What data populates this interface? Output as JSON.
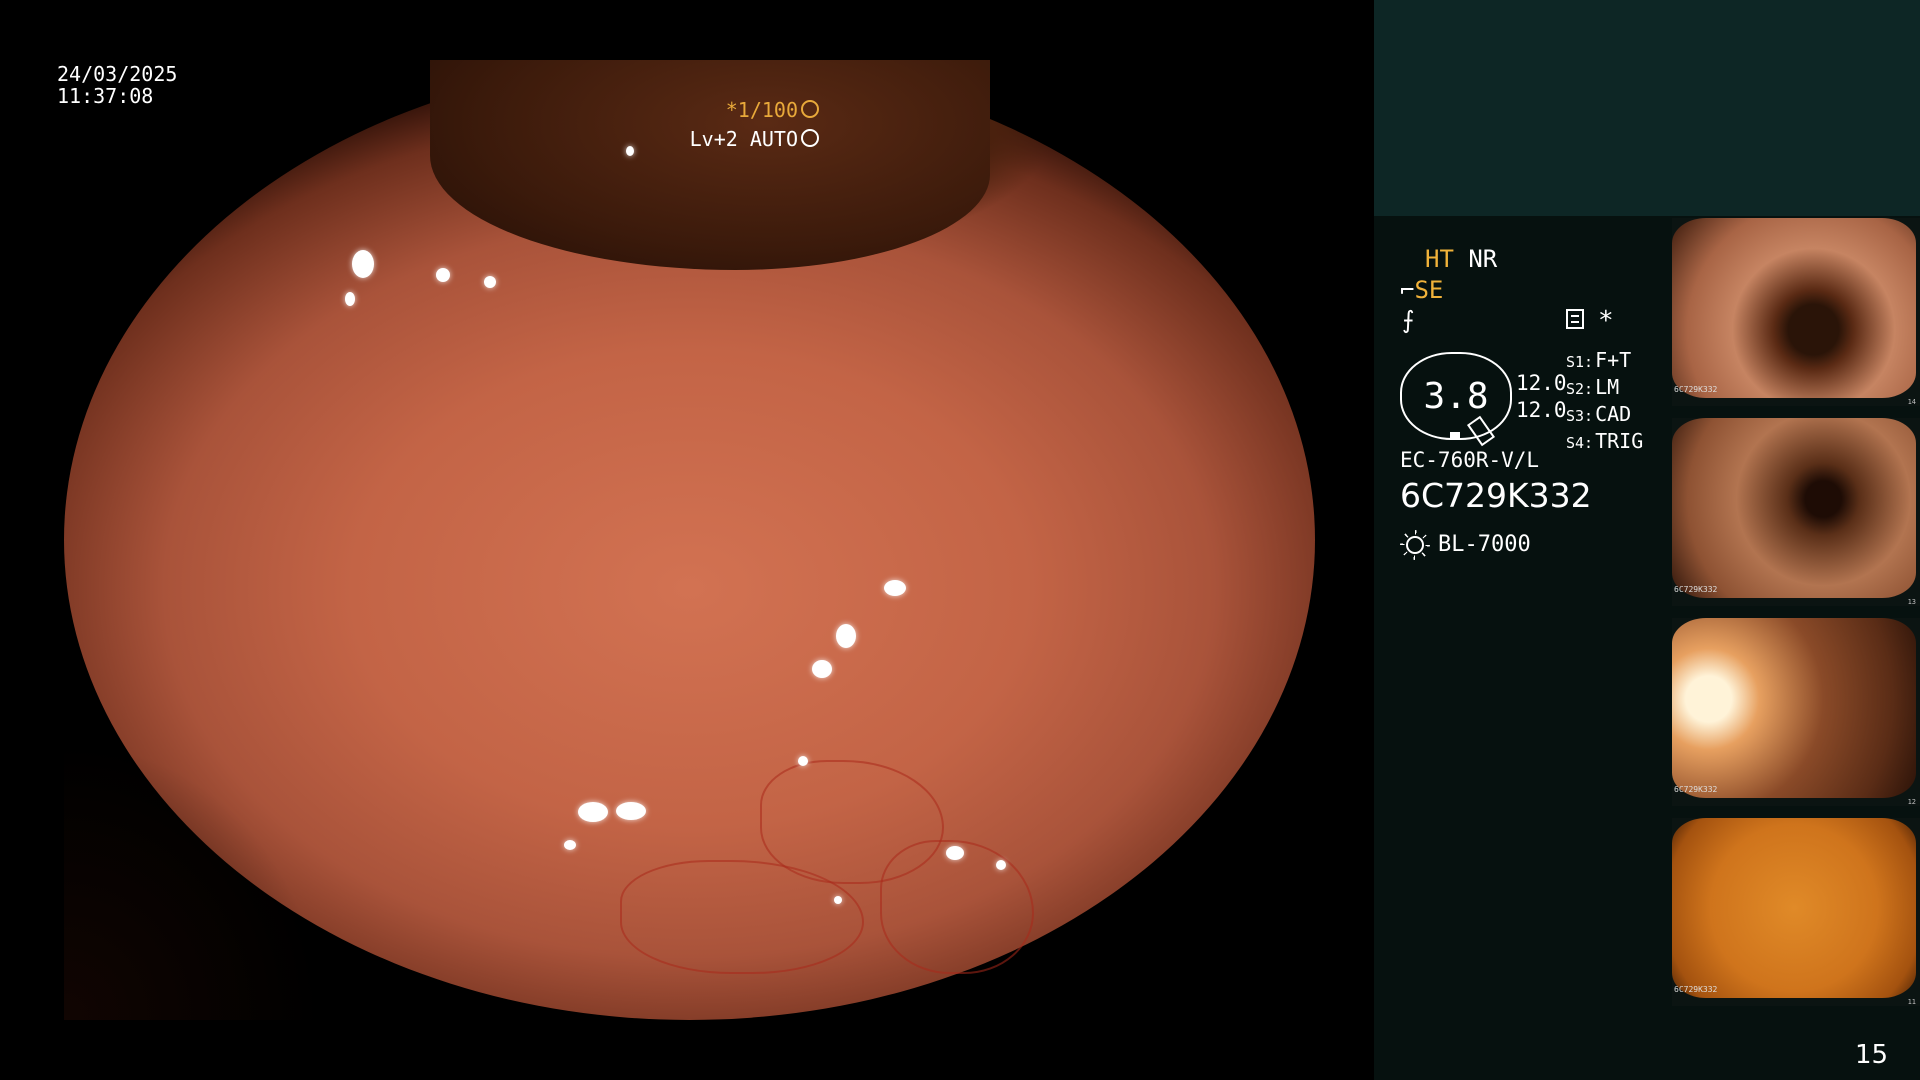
{
  "overlay": {
    "date": "24/03/2025",
    "time": "11:37:08",
    "shutter": "*1/100",
    "shutter_icon": "aperture-icon",
    "enhancement": "Lv+2 AUTO",
    "enhancement_icon": "auto-exposure-icon"
  },
  "panel": {
    "ht_label": "HT",
    "nr_label": "NR",
    "se_label": "SE",
    "star": "*",
    "gauge_value": "3.8",
    "zoom_values": [
      "12.0",
      "12.0"
    ],
    "switches": [
      {
        "key": "S1:",
        "value": "F+T"
      },
      {
        "key": "S2:",
        "value": "LM"
      },
      {
        "key": "S3:",
        "value": "CAD"
      },
      {
        "key": "S4:",
        "value": "TRIG"
      }
    ],
    "scope_model": "EC-760R-V/L",
    "scope_serial": "6C729K332",
    "light_source": "BL-7000"
  },
  "thumbnails": [
    {
      "caption": "6C729K332",
      "number": "14"
    },
    {
      "caption": "6C729K332",
      "number": "13"
    },
    {
      "caption": "6C729K332",
      "number": "12"
    },
    {
      "caption": "6C729K332",
      "number": "11"
    }
  ],
  "page_number": "15",
  "colors": {
    "accent_orange": "#f0b23a",
    "panel_top": "#0d2625",
    "panel_bg": "#06110f"
  }
}
